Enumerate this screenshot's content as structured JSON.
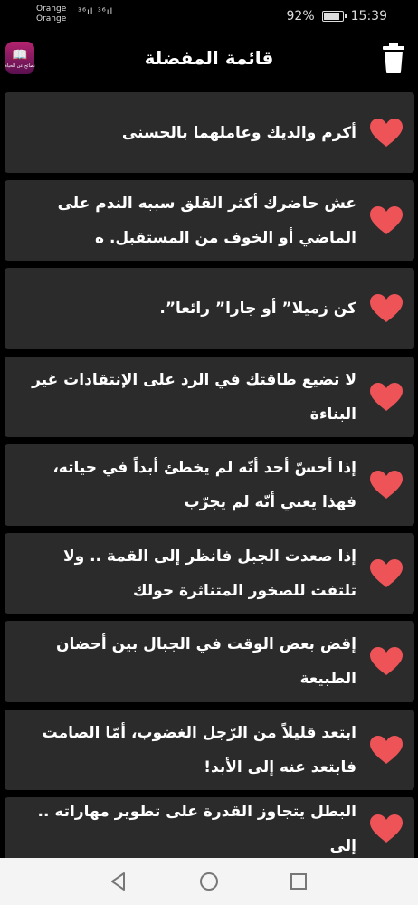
{
  "status_bar": {
    "carrier_1": "Orange",
    "carrier_2": "Orange",
    "signal_text": "³⁶ıl ³⁶ıl",
    "battery_percent": "92%",
    "battery_level": 0.92,
    "time": "15:39"
  },
  "header": {
    "title": "قائمة المفضلة",
    "logo_text": "نصائح عن الحياة",
    "icons": {
      "logo": "book-icon",
      "action": "trash-icon"
    }
  },
  "colors": {
    "background": "#000000",
    "card": "#2b2b2b",
    "heart": "#ee5357",
    "nav_bar": "#f4f4f4"
  },
  "favorites": [
    {
      "text": "أكرم والديك وعاملهما بالحسنى"
    },
    {
      "text": "عش حاضرك أكثر القلق سببه الندم على الماضي أو الخوف من المستقبل. ه"
    },
    {
      "text": "كن زميلا” أو جارا” رائعا”."
    },
    {
      "text": "لا تضيع طاقتك في الرد على الإنتقادات غير البناءة"
    },
    {
      "text": "إذا أحسّ أحد أنّه لم يخطئ أبداً في حياته، فهذا يعني أنّه لم يجرّب"
    },
    {
      "text": "إذا صعدت الجبل فانظر إلى القمة .. ولا تلتفت للصخور المتناثرة حولك"
    },
    {
      "text": "إقض بعض الوقت في الجبال بين أحضان الطبيعة"
    },
    {
      "text": "ابتعد قليلاً من الرّجل الغضوب، أمّا الصامت فابتعد عنه إلى الأبد!"
    },
    {
      "text": "البطل يتجاوز القدرة على تطوير مهاراته .. إلى"
    }
  ],
  "nav": {
    "back": "back-icon",
    "home": "home-icon",
    "recents": "recents-icon"
  }
}
